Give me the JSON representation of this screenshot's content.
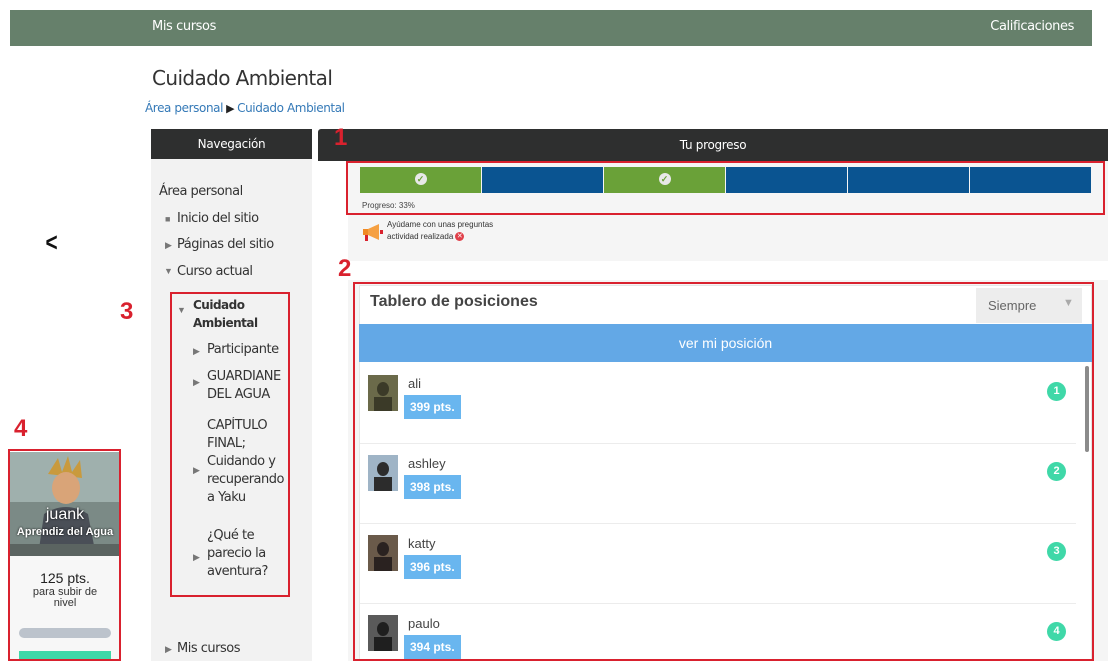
{
  "topbar": {
    "left_link": "Mis cursos",
    "right_link": "Calificaciones"
  },
  "page_title": "Cuidado Ambiental",
  "breadcrumb": {
    "home": "Área personal",
    "separator": "▶",
    "current": "Cuidado Ambiental"
  },
  "navigation": {
    "header": "Navegación",
    "root": "Área personal",
    "items": [
      "Inicio del sitio",
      "Páginas del sitio",
      "Curso actual"
    ],
    "course": {
      "title_line1": "Cuidado",
      "title_line2": "Ambiental"
    },
    "course_items": [
      {
        "lines": [
          "Participante"
        ]
      },
      {
        "lines": [
          "GUARDIANE",
          "DEL AGUA"
        ]
      },
      {
        "lines": [
          "CAPÍTULO",
          "FINAL;",
          "Cuidando y",
          "recuperando",
          "a Yaku"
        ]
      },
      {
        "lines": [
          "¿Qué te",
          "parecio la",
          "aventura?"
        ]
      }
    ],
    "bottom_item": "Mis cursos"
  },
  "progress": {
    "header": "Tu progreso",
    "segments": [
      {
        "done": true,
        "color": "#6aa138"
      },
      {
        "done": false,
        "color": "#0a5491"
      },
      {
        "done": true,
        "color": "#6aa138"
      },
      {
        "done": false,
        "color": "#0a5491"
      },
      {
        "done": false,
        "color": "#0a5491"
      },
      {
        "done": false,
        "color": "#0a5491"
      }
    ],
    "label": "Progreso: 33%",
    "notice_line1": "Ayúdame con unas preguntas",
    "notice_line2": "actividad realizada",
    "icons": {
      "notice": "megaphone-icon",
      "status": "error-icon",
      "done": "check-icon"
    }
  },
  "leaderboard": {
    "title": "Tablero de posiciones",
    "filter": "Siempre",
    "my_position_button": "ver mi posición",
    "rows": [
      {
        "name": "ali",
        "points": "399 pts.",
        "rank": "1"
      },
      {
        "name": "ashley",
        "points": "398 pts.",
        "rank": "2"
      },
      {
        "name": "katty",
        "points": "396 pts.",
        "rank": "3"
      },
      {
        "name": "paulo",
        "points": "394 pts.",
        "rank": "4"
      }
    ]
  },
  "player": {
    "name": "juank",
    "rank": "Aprendiz del Agua",
    "points": "125 pts.",
    "subtitle_line1": "para subir de",
    "subtitle_line2": "nivel",
    "level_progress": 0.0
  },
  "annotations": [
    "1",
    "2",
    "3",
    "4"
  ],
  "colors": {
    "accent_green": "#6aa138",
    "accent_blue": "#0a5491",
    "rank_green": "#3fd8a8",
    "annotation_red": "#d9212e"
  }
}
